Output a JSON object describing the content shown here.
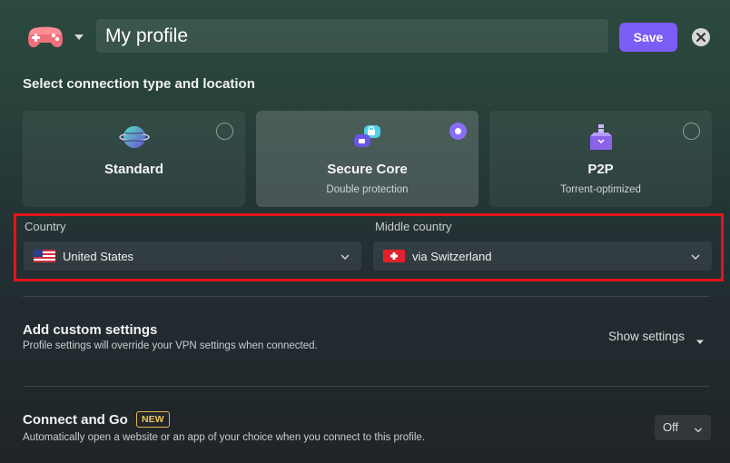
{
  "header": {
    "profile_icon": "gamepad-icon",
    "profile_name": "My profile",
    "save_label": "Save",
    "close_icon": "close-icon"
  },
  "connection": {
    "title": "Select connection type and location",
    "options": [
      {
        "title": "Standard",
        "subtitle": "",
        "icon": "globe-icon",
        "selected": false
      },
      {
        "title": "Secure Core",
        "subtitle": "Double protection",
        "icon": "secure-core-icon",
        "selected": true
      },
      {
        "title": "P2P",
        "subtitle": "Torrent-optimized",
        "icon": "p2p-icon",
        "selected": false
      }
    ]
  },
  "location": {
    "country_label": "Country",
    "country_value": "United States",
    "country_flag": "us-flag-icon",
    "middle_label": "Middle country",
    "middle_value": "via Switzerland",
    "middle_flag": "ch-flag-icon"
  },
  "custom_settings": {
    "title": "Add custom settings",
    "description": "Profile settings will override your VPN settings when connected.",
    "toggle_label": "Show settings"
  },
  "connect_and_go": {
    "title": "Connect and Go",
    "badge": "NEW",
    "description": "Automatically open a website or an app of your choice when you connect to this profile.",
    "value": "Off"
  },
  "colors": {
    "accent": "#7b5cf5",
    "highlight": "#e4141b",
    "badge": "#e3b54d"
  }
}
